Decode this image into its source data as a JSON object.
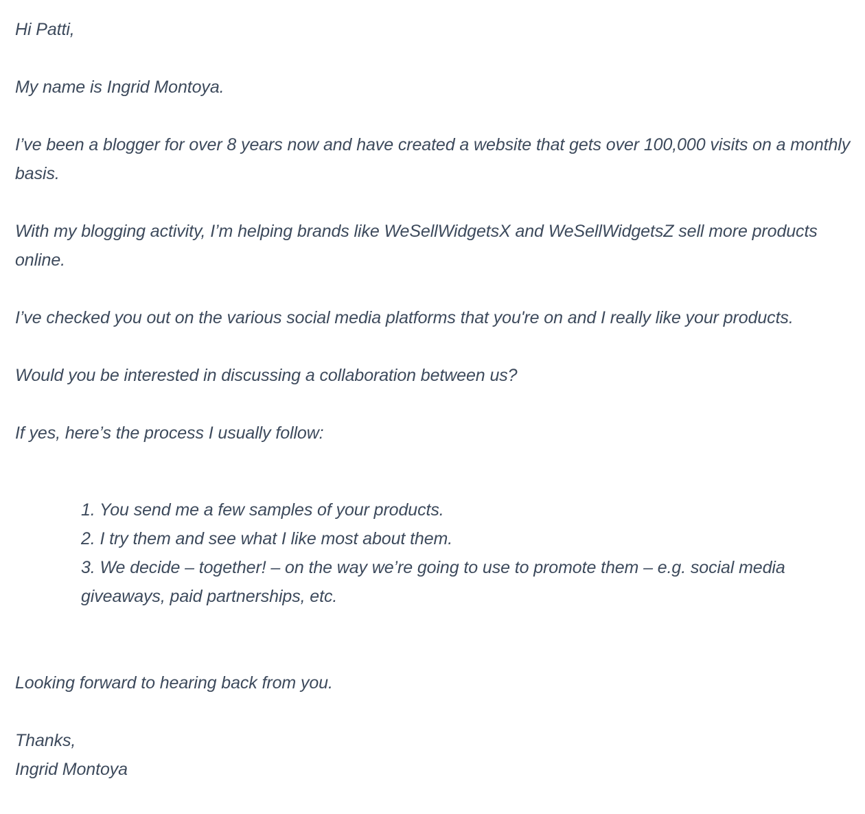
{
  "email": {
    "greeting": "Hi Patti,",
    "paragraphs": [
      "My name is Ingrid Montoya.",
      "I’ve been a blogger for over 8 years now and have created a website that gets over 100,000 visits on a monthly basis.",
      "With my blogging activity, I’m helping brands like WeSellWidgetsX and WeSellWidgetsZ sell more products online.",
      "I’ve checked you out on the various social media platforms that you're on and I really like your products.",
      "Would you be interested in discussing a collaboration between us?",
      "If yes, here’s the process I usually follow:"
    ],
    "process_steps": [
      "1. You send me a few samples of your products.",
      "2. I try them and see what I like most about them.",
      "3. We decide – together! – on the way we’re going to use to promote them – e.g. social media giveaways, paid partnerships, etc."
    ],
    "closing": "Looking forward to hearing back from you.",
    "signoff": "Thanks,",
    "signature": "Ingrid Montoya"
  },
  "colors": {
    "text": "#3d4a5c",
    "background": "#ffffff"
  }
}
